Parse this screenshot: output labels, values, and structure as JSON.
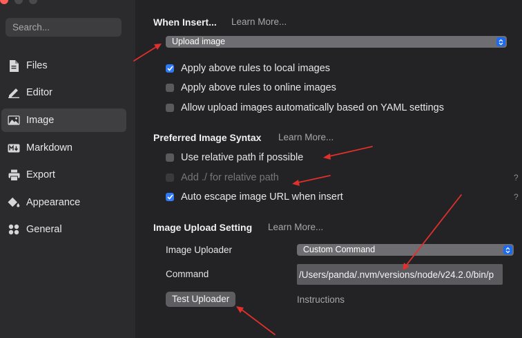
{
  "sidebar": {
    "search_placeholder": "Search...",
    "items": [
      {
        "label": "Files",
        "icon": "file-icon"
      },
      {
        "label": "Editor",
        "icon": "pencil-icon"
      },
      {
        "label": "Image",
        "icon": "image-icon",
        "active": true
      },
      {
        "label": "Markdown",
        "icon": "markdown-icon"
      },
      {
        "label": "Export",
        "icon": "printer-icon"
      },
      {
        "label": "Appearance",
        "icon": "paint-bucket-icon"
      },
      {
        "label": "General",
        "icon": "grid-icon"
      }
    ]
  },
  "when_insert": {
    "title": "When Insert...",
    "learn_more": "Learn More...",
    "selected": "Upload image",
    "options": [
      {
        "label": "Apply above rules to local images",
        "checked": true
      },
      {
        "label": "Apply above rules to online images",
        "checked": false
      },
      {
        "label": "Allow upload images automatically based on YAML settings",
        "checked": false
      }
    ]
  },
  "syntax": {
    "title": "Preferred Image Syntax",
    "learn_more": "Learn More...",
    "options": [
      {
        "label": "Use relative path if possible",
        "checked": false
      },
      {
        "label": "Add ./ for relative path",
        "checked": false,
        "disabled": true,
        "help": "?"
      },
      {
        "label": "Auto escape image URL when insert",
        "checked": true,
        "help": "?"
      }
    ]
  },
  "upload": {
    "title": "Image Upload Setting",
    "learn_more": "Learn More...",
    "uploader_label": "Image Uploader",
    "uploader_value": "Custom Command",
    "command_label": "Command",
    "command_value": "/Users/panda/.nvm/versions/node/v24.2.0/bin/p",
    "test_button": "Test Uploader",
    "instructions": "Instructions"
  },
  "colors": {
    "accent": "#2f7bf6",
    "annotation_arrow": "#e0302c"
  }
}
